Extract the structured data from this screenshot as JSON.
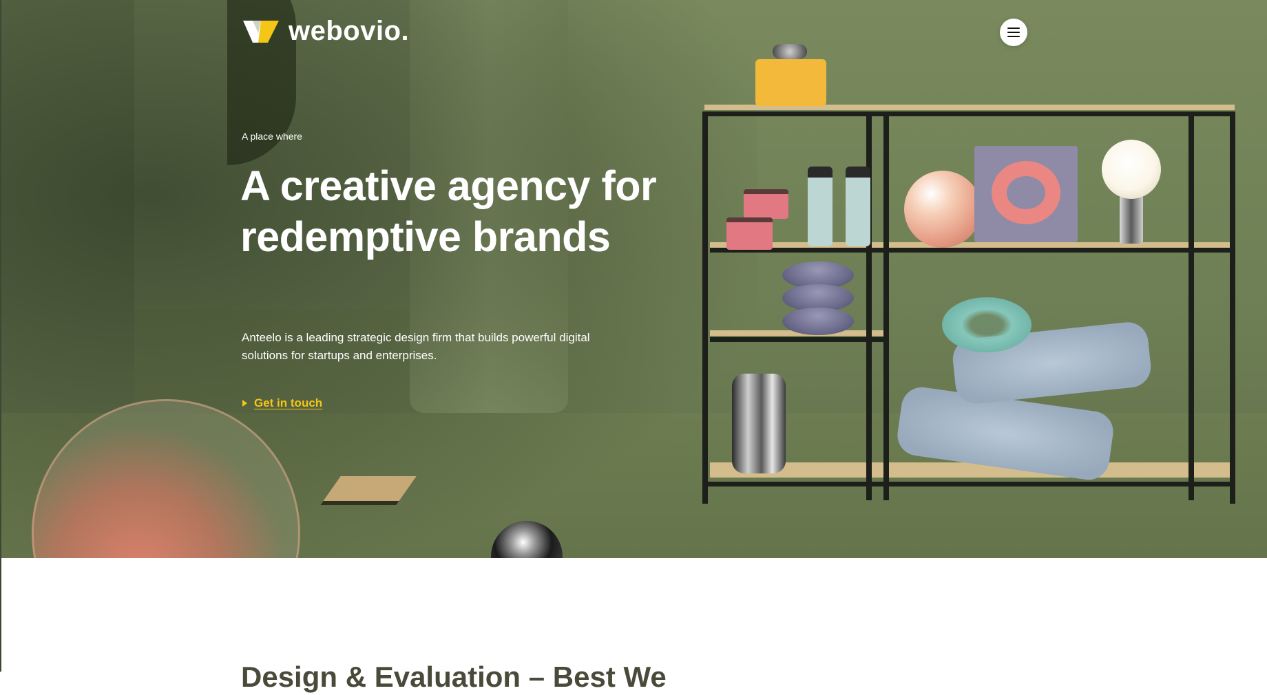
{
  "brand": {
    "name": "webovio.",
    "accent_color": "#f5c518",
    "hero_color": "#738359"
  },
  "nav": {
    "menu_icon": "hamburger-icon"
  },
  "hero": {
    "kicker": "A place where",
    "headline": "A creative agency for redemptive brands",
    "description": "Anteelo is a leading strategic design firm that builds powerful digital solutions for startups and enterprises.",
    "cta_label": "Get in touch",
    "cta_icon": "play-arrow-icon"
  },
  "next_section": {
    "title": "Design & Evaluation – Best We"
  }
}
